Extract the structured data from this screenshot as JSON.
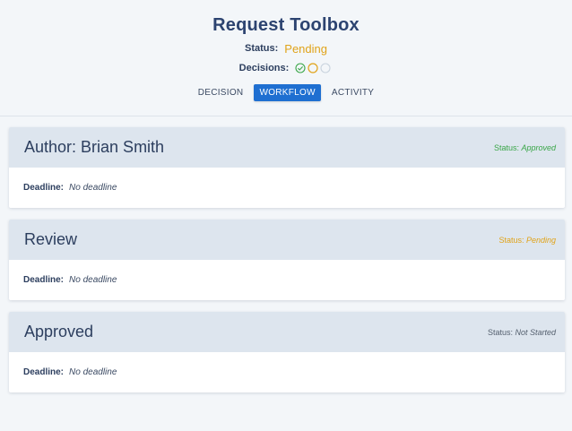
{
  "header": {
    "title": "Request Toolbox",
    "status_label": "Status:",
    "status_value": "Pending",
    "decisions_label": "Decisions:",
    "decisions": [
      {
        "state": "approved",
        "icon": "check-circle-icon",
        "color": "#3aa648"
      },
      {
        "state": "pending",
        "icon": "circle-icon",
        "color": "#e0a319"
      },
      {
        "state": "not-started",
        "icon": "circle-icon",
        "color": "#c9d3de"
      }
    ]
  },
  "tabs": [
    {
      "label": "DECISION",
      "active": false
    },
    {
      "label": "WORKFLOW",
      "active": true
    },
    {
      "label": "ACTIVITY",
      "active": false
    }
  ],
  "steps": [
    {
      "title": "Author: Brian Smith",
      "status_label": "Status:",
      "status_value": "Approved",
      "deadline_label": "Deadline:",
      "deadline_value": "No deadline"
    },
    {
      "title": "Review",
      "status_label": "Status:",
      "status_value": "Pending",
      "deadline_label": "Deadline:",
      "deadline_value": "No deadline"
    },
    {
      "title": "Approved",
      "status_label": "Status:",
      "status_value": "Not Started",
      "deadline_label": "Deadline:",
      "deadline_value": "No deadline"
    }
  ],
  "colors": {
    "accent": "#1f6fd1",
    "approved": "#3aa648",
    "pending": "#e0a319",
    "not_started": "#55606f"
  }
}
